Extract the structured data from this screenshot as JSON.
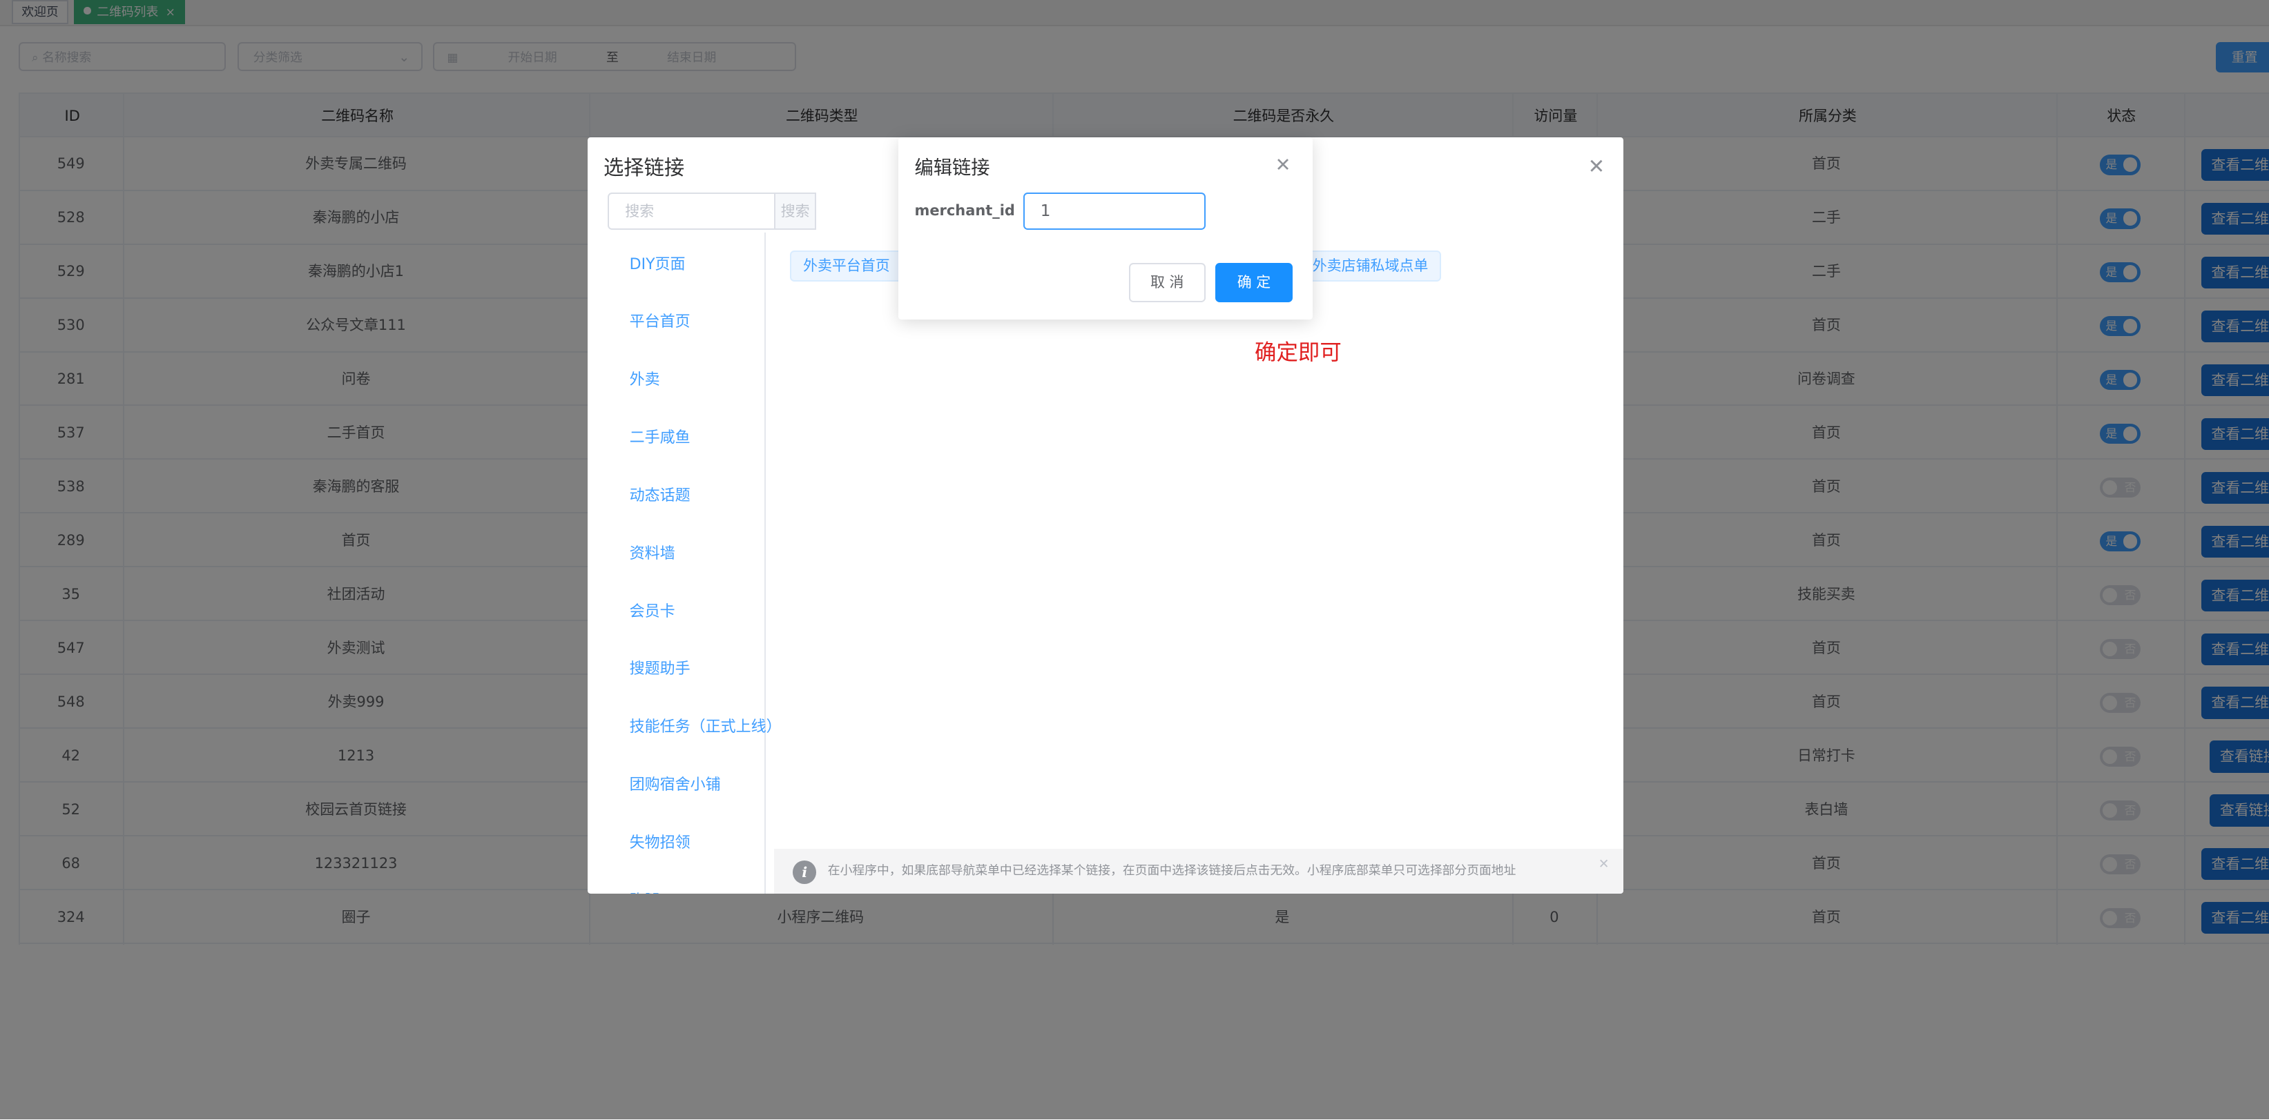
{
  "tabs": [
    {
      "label": "欢迎页",
      "active": false
    },
    {
      "label": "二维码列表",
      "active": true
    }
  ],
  "filters": {
    "name_placeholder": "名称搜索",
    "category_placeholder": "分类筛选",
    "start_date_placeholder": "开始日期",
    "date_sep": "至",
    "end_date_placeholder": "结束日期",
    "reset_label": "重置"
  },
  "table": {
    "headers": [
      "ID",
      "二维码名称",
      "二维码类型",
      "二维码是否永久",
      "访问量",
      "所属分类",
      "状态"
    ],
    "rows": [
      {
        "id": "549",
        "name": "外卖专属二维码",
        "type": "",
        "permanent": "",
        "visits": "",
        "category": "首页",
        "status": true,
        "status_label": "是",
        "action": "查看二维码"
      },
      {
        "id": "528",
        "name": "秦海鹏的小店",
        "type": "",
        "permanent": "",
        "visits": "",
        "category": "二手",
        "status": true,
        "status_label": "是",
        "action": "查看二维码"
      },
      {
        "id": "529",
        "name": "秦海鹏的小店1",
        "type": "",
        "permanent": "",
        "visits": "",
        "category": "二手",
        "status": true,
        "status_label": "是",
        "action": "查看二维码"
      },
      {
        "id": "530",
        "name": "公众号文章111",
        "type": "",
        "permanent": "",
        "visits": "",
        "category": "首页",
        "status": true,
        "status_label": "是",
        "action": "查看二维码"
      },
      {
        "id": "281",
        "name": "问卷",
        "type": "",
        "permanent": "",
        "visits": "",
        "category": "问卷调查",
        "status": true,
        "status_label": "是",
        "action": "查看二维码"
      },
      {
        "id": "537",
        "name": "二手首页",
        "type": "",
        "permanent": "",
        "visits": "",
        "category": "首页",
        "status": true,
        "status_label": "是",
        "action": "查看二维码"
      },
      {
        "id": "538",
        "name": "秦海鹏的客服",
        "type": "",
        "permanent": "",
        "visits": "",
        "category": "首页",
        "status": false,
        "status_label": "否",
        "action": "查看二维码"
      },
      {
        "id": "289",
        "name": "首页",
        "type": "",
        "permanent": "",
        "visits": "",
        "category": "首页",
        "status": true,
        "status_label": "是",
        "action": "查看二维码"
      },
      {
        "id": "35",
        "name": "社团活动",
        "type": "",
        "permanent": "",
        "visits": "",
        "category": "技能买卖",
        "status": false,
        "status_label": "否",
        "action": "查看二维码"
      },
      {
        "id": "547",
        "name": "外卖测试",
        "type": "",
        "permanent": "",
        "visits": "",
        "category": "首页",
        "status": false,
        "status_label": "否",
        "action": "查看二维码"
      },
      {
        "id": "548",
        "name": "外卖999",
        "type": "",
        "permanent": "",
        "visits": "",
        "category": "首页",
        "status": false,
        "status_label": "否",
        "action": "查看二维码"
      },
      {
        "id": "42",
        "name": "1213",
        "type": "",
        "permanent": "",
        "visits": "",
        "category": "日常打卡",
        "status": false,
        "status_label": "否",
        "action": "查看链接"
      },
      {
        "id": "52",
        "name": "校园云首页链接",
        "type": "",
        "permanent": "",
        "visits": "",
        "category": "表白墙",
        "status": false,
        "status_label": "否",
        "action": "查看链接"
      },
      {
        "id": "68",
        "name": "123321123",
        "type": "",
        "permanent": "",
        "visits": "",
        "category": "首页",
        "status": false,
        "status_label": "否",
        "action": "查看二维码"
      },
      {
        "id": "324",
        "name": "圈子",
        "type": "小程序二维码",
        "permanent": "是",
        "visits": "0",
        "category": "首页",
        "status": false,
        "status_label": "否",
        "action": "查看二维码"
      }
    ]
  },
  "select_link_dialog": {
    "title": "选择链接",
    "search_placeholder": "搜索",
    "search_button": "搜索",
    "menu": [
      "DIY页面",
      "平台首页",
      "外卖",
      "二手咸鱼",
      "动态话题",
      "资料墙",
      "会员卡",
      "搜题助手",
      "技能任务（正式上线）",
      "团购宿舍小铺",
      "失物招领",
      "跑腿"
    ],
    "chips": [
      "外卖平台首页",
      "外卖店铺私域点单"
    ],
    "info_text": "在小程序中，如果底部导航菜单中已经选择某个链接，在页面中选择该链接后点击无效。小程序底部菜单只可选择部分页面地址",
    "annotation": "确定即可",
    "annotation_color": "#e02020"
  },
  "edit_link_dialog": {
    "title": "编辑链接",
    "field_label": "merchant_id",
    "field_value": "1",
    "cancel_label": "取 消",
    "ok_label": "确 定"
  },
  "colors": {
    "primary": "#409eff",
    "active_tab": "#42b983",
    "action_button": "#1a73d9"
  }
}
